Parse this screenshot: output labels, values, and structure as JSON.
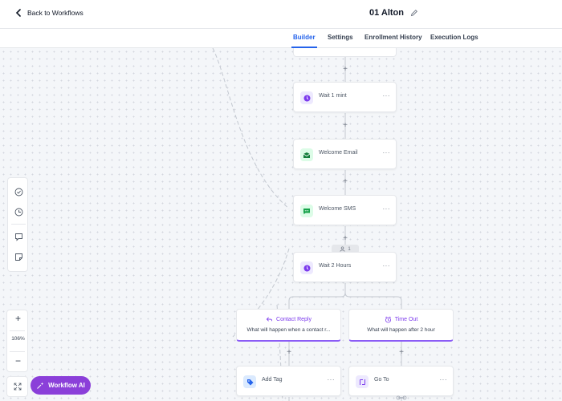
{
  "header": {
    "back_label": "Back to Workflows",
    "workflow_name": "01 Alton"
  },
  "tabs": [
    {
      "label": "Builder",
      "active": true
    },
    {
      "label": "Settings",
      "active": false
    },
    {
      "label": "Enrollment History",
      "active": false
    },
    {
      "label": "Execution Logs",
      "active": false
    }
  ],
  "nodes": [
    {
      "label": "Wait 1 mint",
      "icon": "clock-icon",
      "color": "#7c3aed"
    },
    {
      "label": "Welcome Email",
      "icon": "email-icon",
      "color": "#15803d"
    },
    {
      "label": "Welcome SMS",
      "icon": "sms-icon",
      "color": "#16a34a"
    },
    {
      "label": "Wait 2 Hours",
      "icon": "clock-icon",
      "color": "#7c3aed"
    }
  ],
  "counter_badge": "1",
  "branches": [
    {
      "title": "Contact Reply",
      "icon": "reply-icon",
      "description": "What will happen when a contact r..."
    },
    {
      "title": "Time Out",
      "icon": "alarm-clock-icon",
      "description": "What will happen after 2 hour"
    }
  ],
  "branch_actions": [
    {
      "label": "Add Tag",
      "icon": "tag-icon",
      "color": "#2563eb"
    },
    {
      "label": "Go To",
      "icon": "goto-icon",
      "color": "#7c3aed"
    }
  ],
  "zoom": {
    "level": "106%"
  },
  "ai_button": {
    "label": "Workflow AI"
  },
  "colors": {
    "accent": "#2563eb",
    "brand_purple": "#8b3fd9",
    "branch_border": "#8b5cf6"
  }
}
